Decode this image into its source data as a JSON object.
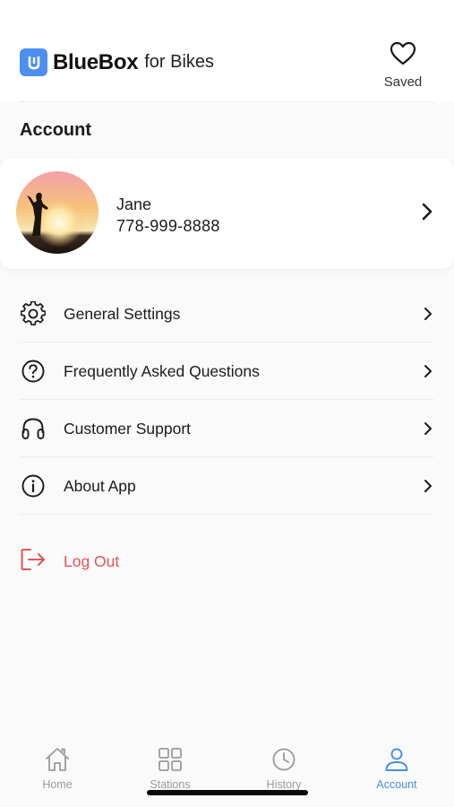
{
  "header": {
    "brand_name": "BlueBox",
    "brand_suffix": "for Bikes",
    "saved_label": "Saved"
  },
  "account": {
    "section_title": "Account",
    "profile": {
      "name": "Jane",
      "phone": "778-999-8888"
    }
  },
  "menu": {
    "items": [
      {
        "label": "General Settings",
        "icon": "gear-icon"
      },
      {
        "label": "Frequently Asked Questions",
        "icon": "question-circle-icon"
      },
      {
        "label": "Customer Support",
        "icon": "headphones-icon"
      },
      {
        "label": "About App",
        "icon": "info-circle-icon"
      }
    ],
    "logout_label": "Log Out"
  },
  "tabbar": {
    "tabs": [
      {
        "label": "Home",
        "icon": "home-icon"
      },
      {
        "label": "Stations",
        "icon": "grid-icon"
      },
      {
        "label": "History",
        "icon": "clock-icon"
      },
      {
        "label": "Account",
        "icon": "person-icon"
      }
    ],
    "active_tab": "Account"
  },
  "colors": {
    "brand_blue": "#4d8ff0",
    "active_tab": "#4a8de8",
    "inactive_tab": "#9a9a9a",
    "logout_red": "#e0555a"
  }
}
